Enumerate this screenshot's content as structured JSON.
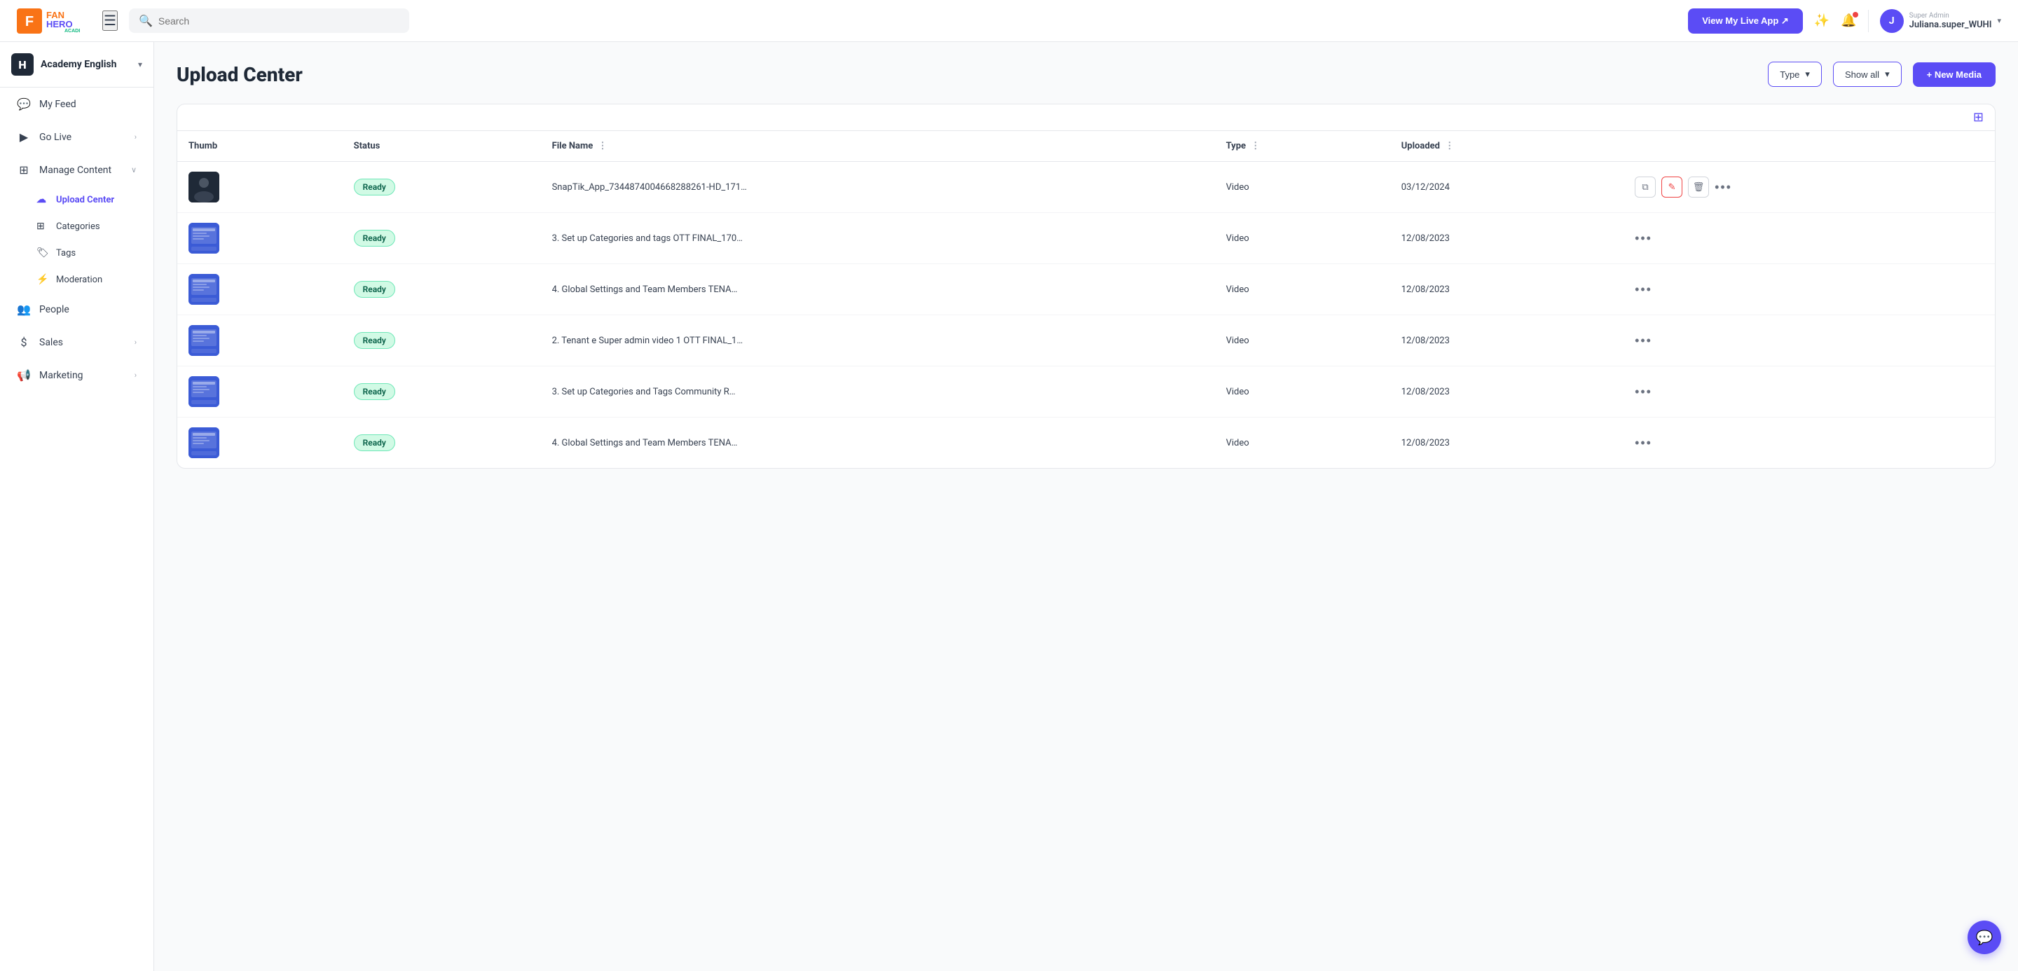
{
  "app": {
    "logo_fan": "FAN",
    "logo_hero": "HERO",
    "logo_sub": "ACADEMY"
  },
  "topnav": {
    "search_placeholder": "Search",
    "view_live_label": "View My Live App ↗",
    "user_role": "Super Admin",
    "user_name": "Juliana.super_WUHI",
    "user_initial": "J",
    "chevron": "▾"
  },
  "sidebar": {
    "workspace_name": "Academy English",
    "workspace_chevron": "▾",
    "workspace_icon": "H",
    "items": [
      {
        "id": "my-feed",
        "label": "My Feed",
        "icon": "💬",
        "active": false
      },
      {
        "id": "go-live",
        "label": "Go Live",
        "icon": "▶",
        "active": false,
        "has_chevron": true
      },
      {
        "id": "manage-content",
        "label": "Manage Content",
        "icon": "⊞",
        "active": false,
        "has_chevron": true
      }
    ],
    "sub_items": [
      {
        "id": "upload-center",
        "label": "Upload Center",
        "icon": "☁",
        "active": true
      },
      {
        "id": "categories",
        "label": "Categories",
        "icon": "⊞",
        "active": false
      },
      {
        "id": "tags",
        "label": "Tags",
        "icon": "🏷",
        "active": false
      },
      {
        "id": "moderation",
        "label": "Moderation",
        "icon": "⚡",
        "active": false
      }
    ],
    "bottom_items": [
      {
        "id": "people",
        "label": "People",
        "icon": "👥",
        "active": false
      },
      {
        "id": "sales",
        "label": "Sales",
        "icon": "$",
        "active": false,
        "has_chevron": true
      },
      {
        "id": "marketing",
        "label": "Marketing",
        "icon": "📢",
        "active": false,
        "has_chevron": true
      }
    ]
  },
  "page": {
    "title": "Upload Center",
    "type_filter_label": "Type",
    "show_all_label": "Show all",
    "new_media_label": "+ New Media"
  },
  "table": {
    "columns": [
      {
        "id": "thumb",
        "label": "Thumb"
      },
      {
        "id": "status",
        "label": "Status"
      },
      {
        "id": "filename",
        "label": "File Name"
      },
      {
        "id": "type",
        "label": "Type"
      },
      {
        "id": "uploaded",
        "label": "Uploaded"
      }
    ],
    "rows": [
      {
        "id": 1,
        "thumb_color": "#1f2937",
        "status": "Ready",
        "filename": "SnapTik_App_7344874004668288261-HD_171…",
        "type": "Video",
        "uploaded": "03/12/2024",
        "highlighted": true
      },
      {
        "id": 2,
        "thumb_color": "#3b5bd6",
        "status": "Ready",
        "filename": "3. Set up Categories and tags OTT FINAL_170…",
        "type": "Video",
        "uploaded": "12/08/2023",
        "highlighted": false
      },
      {
        "id": 3,
        "thumb_color": "#3b5bd6",
        "status": "Ready",
        "filename": "4. Global Settings and Team Members TENA…",
        "type": "Video",
        "uploaded": "12/08/2023",
        "highlighted": false
      },
      {
        "id": 4,
        "thumb_color": "#3b5bd6",
        "status": "Ready",
        "filename": "2. Tenant e Super admin video 1 OTT FINAL_1…",
        "type": "Video",
        "uploaded": "12/08/2023",
        "highlighted": false
      },
      {
        "id": 5,
        "thumb_color": "#3b5bd6",
        "status": "Ready",
        "filename": "3. Set up Categories and Tags Community R…",
        "type": "Video",
        "uploaded": "12/08/2023",
        "highlighted": false
      },
      {
        "id": 6,
        "thumb_color": "#3b5bd6",
        "status": "Ready",
        "filename": "4. Global Settings and Team Members TENA…",
        "type": "Video",
        "uploaded": "12/08/2023",
        "highlighted": false
      }
    ]
  },
  "colors": {
    "brand_purple": "#5b4cf5",
    "status_ready_bg": "#d1fae5",
    "status_ready_text": "#065f46"
  }
}
